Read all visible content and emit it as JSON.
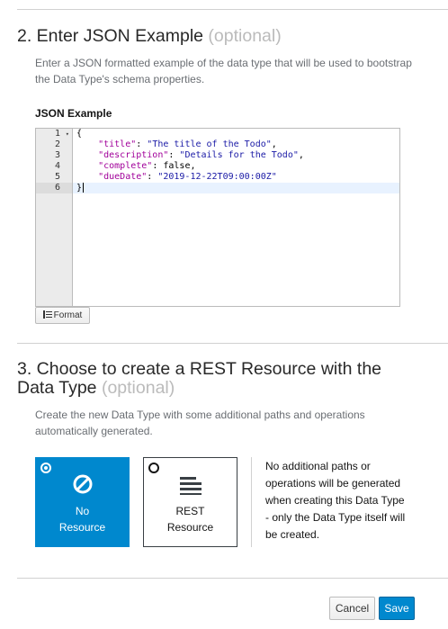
{
  "section2": {
    "number_title": "2. Enter JSON Example",
    "optional": "(optional)",
    "help": "Enter a JSON formatted example of the data type that will be used to bootstrap the Data Type's schema properties.",
    "field_label": "JSON Example",
    "editor": {
      "line_numbers": [
        "1",
        "2",
        "3",
        "4",
        "5",
        "6"
      ],
      "lines": [
        "{",
        "    \"title\": \"The title of the Todo\",",
        "    \"description\": \"Details for the Todo\",",
        "    \"complete\": false,",
        "    \"dueDate\": \"2019-12-22T09:00:00Z\"",
        "}"
      ]
    },
    "format_button": "Format"
  },
  "section3": {
    "title_line1": "3. Choose to create a REST Resource with the",
    "title_line2": "Data Type",
    "optional": "(optional)",
    "help": "Create the new Data Type with some additional paths and operations automatically generated.",
    "options": [
      {
        "label_line1": "No",
        "label_line2": "Resource",
        "selected": true,
        "icon": "ban-icon"
      },
      {
        "label_line1": "REST",
        "label_line2": "Resource",
        "selected": false,
        "icon": "list-icon"
      }
    ],
    "description": "No additional paths or operations will be generated when creating this Data Type - only the Data Type itself will be created."
  },
  "footer": {
    "cancel_label": "Cancel",
    "save_label": "Save"
  },
  "colors": {
    "accent": "#0088ce",
    "optional_text": "#bbbbbb",
    "json_key": "#a1009a",
    "json_string": "#1a1aa6"
  }
}
